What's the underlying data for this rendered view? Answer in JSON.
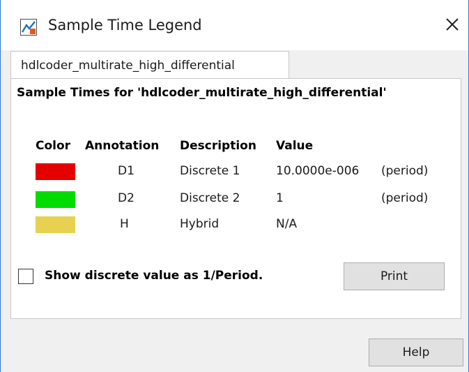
{
  "window": {
    "title": "Sample Time Legend"
  },
  "tabs": [
    {
      "label": "hdlcoder_multirate_high_differential"
    }
  ],
  "panel": {
    "heading": "Sample Times for 'hdlcoder_multirate_high_differential'",
    "columns": {
      "color": "Color",
      "annotation": "Annotation",
      "description": "Description",
      "value": "Value"
    },
    "rows": [
      {
        "color": "#e50000",
        "annotation": "D1",
        "description": "Discrete 1",
        "value": "10.0000e-006",
        "type": "(period)"
      },
      {
        "color": "#00dc00",
        "annotation": "D2",
        "description": "Discrete 2",
        "value": "1",
        "type": "(period)"
      },
      {
        "color": "#e8d150",
        "annotation": "H",
        "description": "Hybrid",
        "value": "N/A",
        "type": ""
      }
    ],
    "checkbox": {
      "label": "Show discrete value as 1/Period.",
      "checked": false
    },
    "print_label": "Print"
  },
  "footer": {
    "help_label": "Help"
  },
  "colors": {
    "window_border": "#2b78d0",
    "button_face": "#e1e1e1",
    "dialog_bg": "#f0f0f0"
  }
}
